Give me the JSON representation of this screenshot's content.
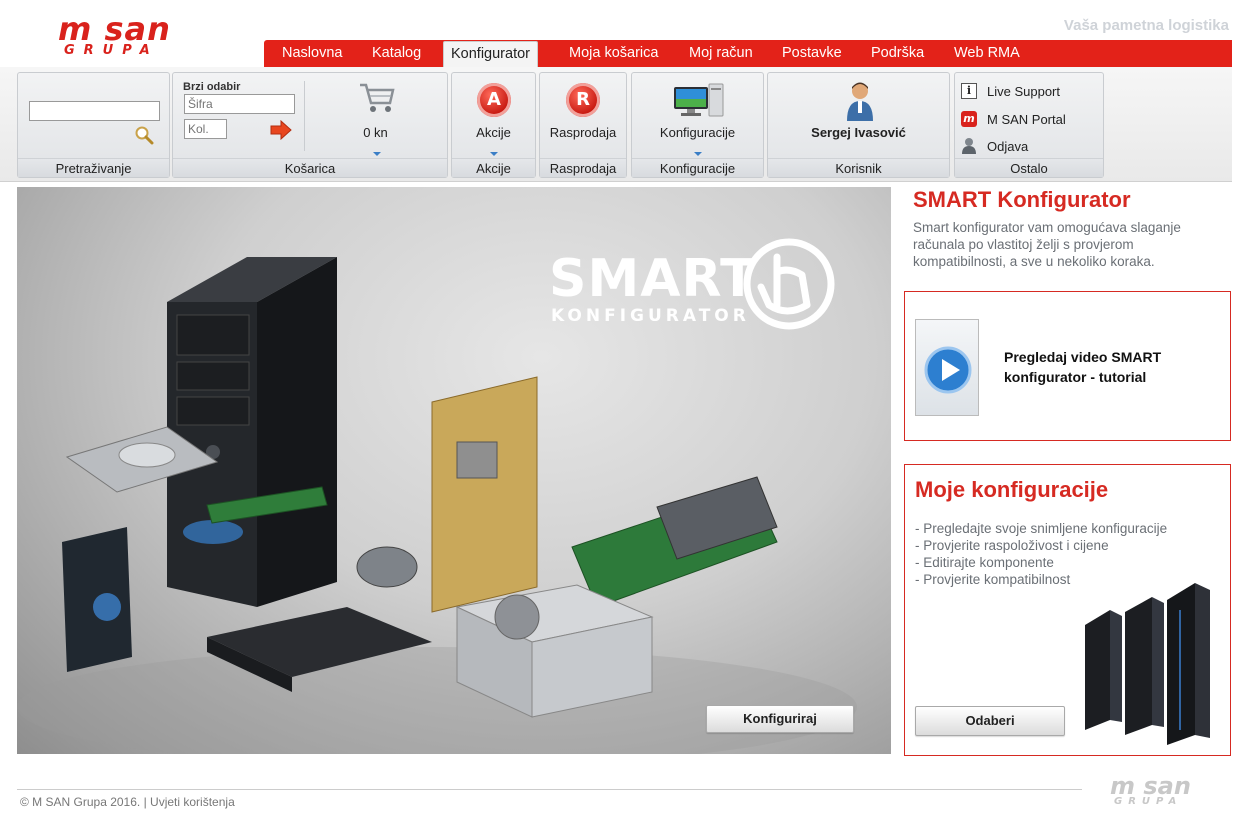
{
  "header": {
    "logo_top": "m san",
    "logo_bottom": "GRUPA",
    "tagline": "Vaša pametna logistika"
  },
  "nav": {
    "items": [
      "Naslovna",
      "Katalog",
      "Konfigurator",
      "Moja košarica",
      "Moj račun",
      "Postavke",
      "Podrška",
      "Web RMA"
    ],
    "active": "Konfigurator"
  },
  "toolbar": {
    "search": {
      "label": "Pretraživanje",
      "value": ""
    },
    "cart": {
      "label": "Košarica",
      "quick_title": "Brzi odabir",
      "code_placeholder": "Šifra",
      "qty_placeholder": "Kol.",
      "amount": "0 kn"
    },
    "promo": {
      "label": "Akcije",
      "caption": "Akcije",
      "letter": "A"
    },
    "sale": {
      "label": "Rasprodaja",
      "caption": "Rasprodaja",
      "letter": "R"
    },
    "configs": {
      "label": "Konfiguracije",
      "caption": "Konfiguracije"
    },
    "user": {
      "label": "Korisnik",
      "name": "Sergej Ivasović"
    },
    "other": {
      "label": "Ostalo",
      "items": [
        "Live Support",
        "M SAN Portal",
        "Odjava"
      ]
    }
  },
  "hero": {
    "title": "SMART",
    "subtitle": "KONFIGURATOR",
    "button": "Konfiguriraj"
  },
  "side": {
    "title": "SMART Konfigurator",
    "description": "Smart konfigurator vam omogućava slaganje računala po vlastitoj želji s provjerom kompatibilnosti, a sve u nekoliko koraka.",
    "video_text": "Pregledaj video SMART konfigurator - tutorial",
    "my_title": "Moje konfiguracije",
    "my_items": [
      "- Pregledajte svoje snimljene konfiguracije",
      "- Provjerite raspoloživost i cijene",
      "- Editirajte komponente",
      "- Provjerite kompatibilnost"
    ],
    "select_button": "Odaberi"
  },
  "footer": {
    "copyright": "© M SAN Grupa 2016.",
    "separator": "|",
    "terms": "Uvjeti korištenja"
  },
  "colors": {
    "brand_red": "#e32219",
    "heading_red": "#d62a22",
    "muted_text": "#6a6f75"
  }
}
